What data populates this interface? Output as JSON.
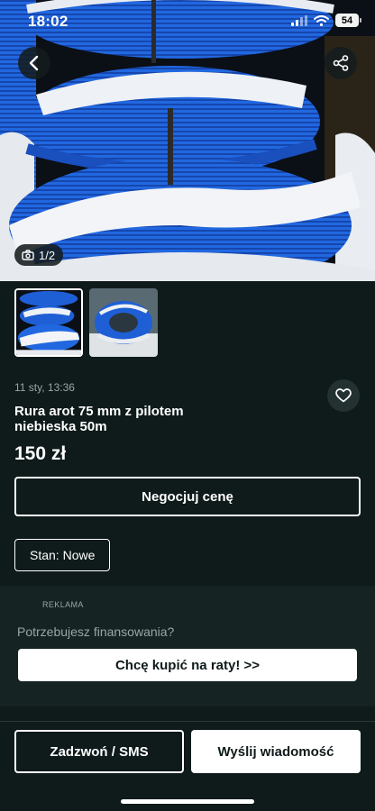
{
  "status_bar": {
    "time": "18:02",
    "battery": "54"
  },
  "nav": {
    "back_icon": "chevron-left-icon",
    "share_icon": "share-icon"
  },
  "gallery": {
    "counter": "1/2",
    "counter_icon": "camera-icon",
    "thumbnails": [
      {
        "name": "thumbnail-1",
        "selected": true
      },
      {
        "name": "thumbnail-2",
        "selected": false
      }
    ]
  },
  "listing": {
    "date": "11 sty, 13:36",
    "title": "Rura arot 75 mm z pilotem\nniebieska  50m",
    "price": "150 zł",
    "negotiate_label": "Negocjuj cenę",
    "condition": "Stan: Nowe",
    "favorite_icon": "heart-icon"
  },
  "ad": {
    "label": "REKLAMA",
    "question": "Potrzebujesz finansowania?",
    "cta": "Chcę kupić na raty! >>"
  },
  "actions": {
    "call_label": "Zadzwoń / SMS",
    "message_label": "Wyślij wiadomość"
  },
  "colors": {
    "background": "#0f1a1a",
    "ad_background": "#162323",
    "pipe_blue": "#1f5fd6",
    "text_muted": "#9aa6a6"
  }
}
